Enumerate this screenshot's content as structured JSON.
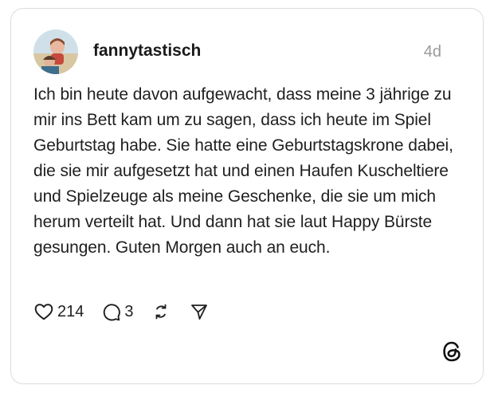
{
  "post": {
    "author": "fannytastisch",
    "timestamp": "4d",
    "text": "Ich bin heute davon aufgewacht, dass meine 3 jährige zu mir ins Bett kam um zu sagen, dass ich heute im Spiel Geburtstag habe. Sie hatte eine Geburtstagskrone dabei, die sie mir aufgesetzt hat und einen Haufen Kuscheltiere und Spielzeuge als meine Geschenke, die sie um mich herum verteilt hat. Und dann hat sie laut Happy Bürste gesungen. Guten Morgen auch an euch."
  },
  "actions": {
    "likes": "214",
    "replies": "3"
  },
  "icons": {
    "like": "heart-icon",
    "reply": "comment-icon",
    "repost": "repost-icon",
    "share": "send-icon",
    "brand": "threads-logo-icon"
  }
}
